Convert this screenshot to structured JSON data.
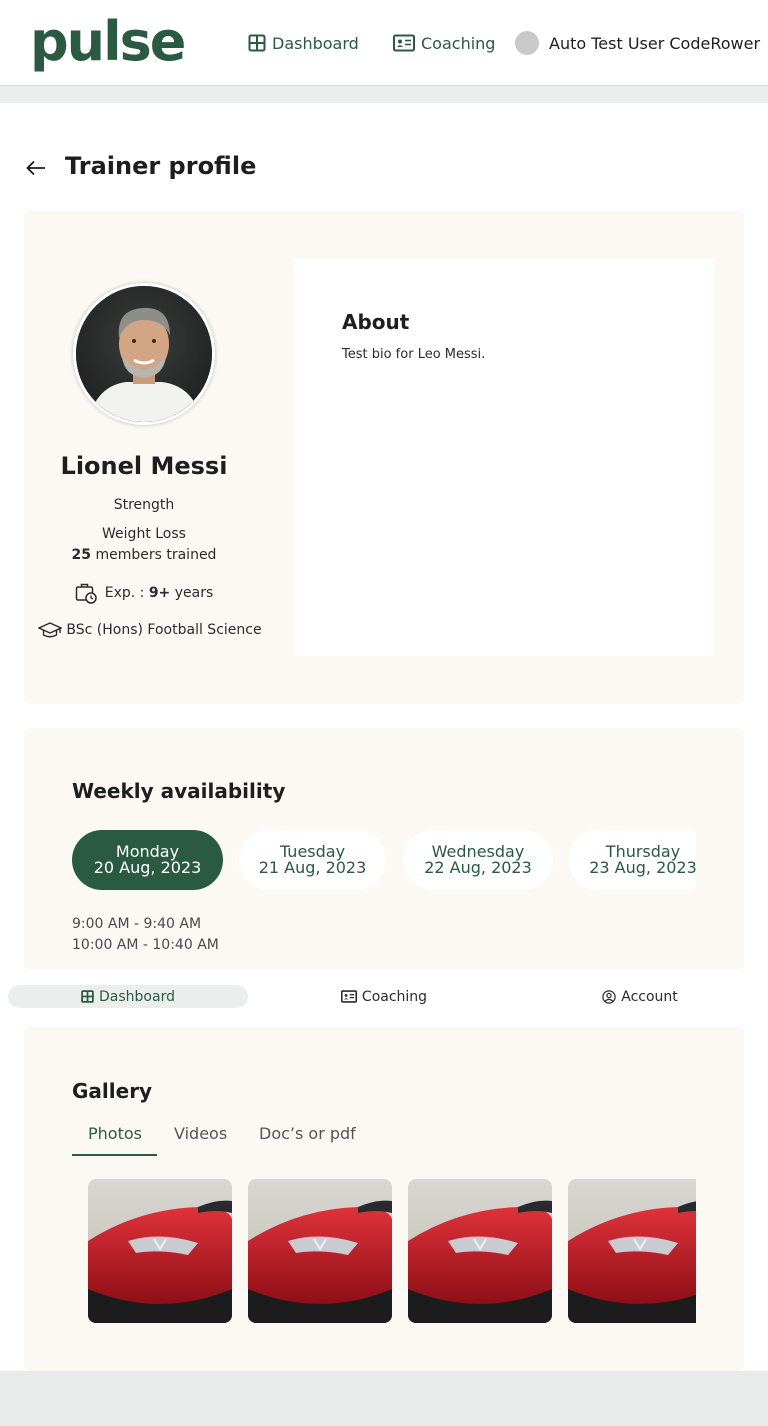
{
  "header": {
    "logo": "pulse",
    "nav": [
      {
        "label": "Dashboard",
        "icon": "dashboard-icon"
      },
      {
        "label": "Coaching",
        "icon": "id-card-icon"
      }
    ],
    "user_name": "Auto Test User CodeRower"
  },
  "page": {
    "title": "Trainer profile"
  },
  "profile": {
    "name": "Lionel Messi",
    "specialty_1": "Strength",
    "specialty_2": "Weight Loss",
    "members_count": "25",
    "members_suffix": " members trained",
    "exp_prefix": "Exp. : ",
    "exp_value": "9+",
    "exp_suffix": " years",
    "education": "BSc (Hons) Football Science"
  },
  "about": {
    "title": "About",
    "text": "Test bio for Leo Messi."
  },
  "availability": {
    "title": "Weekly availability",
    "days": [
      {
        "day": "Monday",
        "date": "20 Aug, 2023",
        "active": true
      },
      {
        "day": "Tuesday",
        "date": "21 Aug, 2023",
        "active": false
      },
      {
        "day": "Wednesday",
        "date": "22 Aug, 2023",
        "active": false
      },
      {
        "day": "Thursday",
        "date": "23 Aug, 2023",
        "active": false
      }
    ],
    "slots": [
      "9:00 AM - 9:40 AM",
      "10:00 AM - 10:40 AM"
    ]
  },
  "bottom_nav": [
    {
      "label": "Dashboard",
      "active": true
    },
    {
      "label": "Coaching",
      "active": false
    },
    {
      "label": "Account",
      "active": false
    }
  ],
  "gallery": {
    "title": "Gallery",
    "tabs": [
      "Photos",
      "Videos",
      "Doc’s or pdf"
    ],
    "active_tab": "Photos"
  },
  "colors": {
    "brand_green": "#2a5a41",
    "card_bg": "#fcf9f5"
  }
}
